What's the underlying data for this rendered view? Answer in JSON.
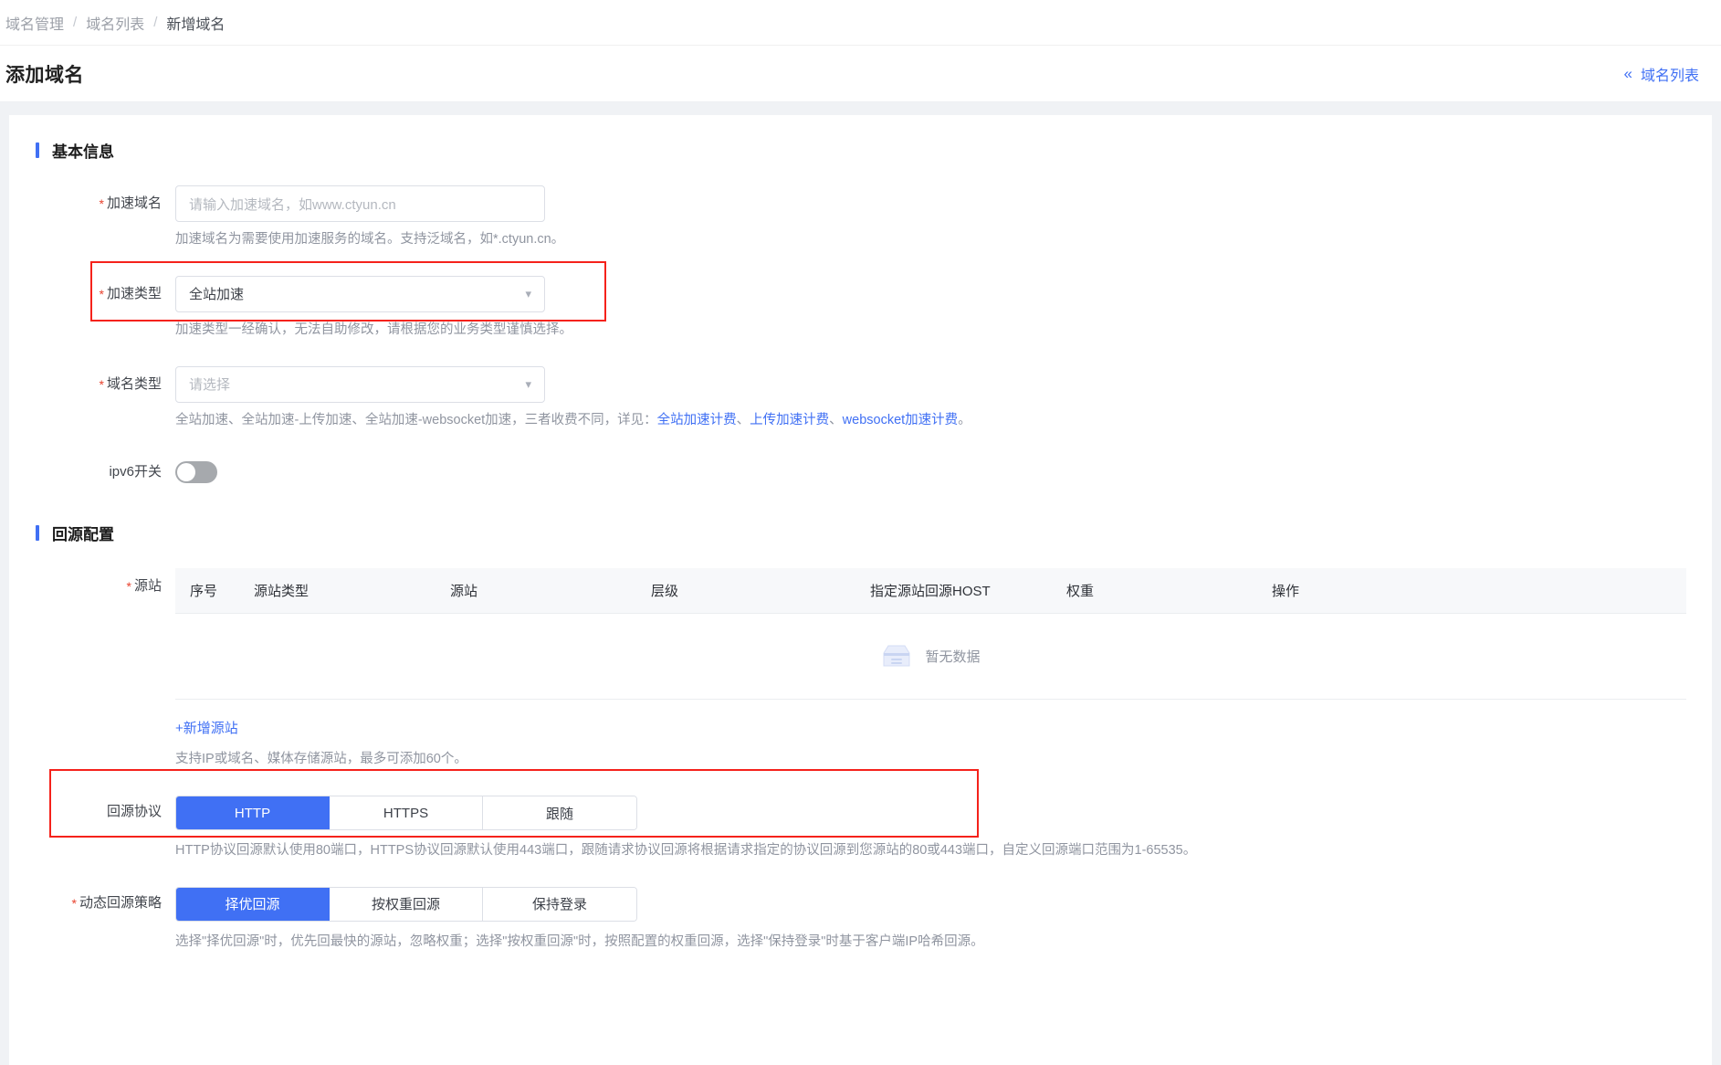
{
  "breadcrumb": {
    "items": [
      "域名管理",
      "域名列表",
      "新增域名"
    ],
    "separator": "/"
  },
  "header": {
    "title": "添加域名",
    "back_link_label": "域名列表",
    "back_link_icon": "double-chevron-left-icon"
  },
  "sections": {
    "basic_info": {
      "title": "基本信息",
      "domain": {
        "label": "加速域名",
        "required": true,
        "value": "",
        "placeholder": "请输入加速域名，如www.ctyun.cn",
        "hint": "加速域名为需要使用加速服务的域名。支持泛域名，如*.ctyun.cn。"
      },
      "accel_type": {
        "label": "加速类型",
        "required": true,
        "value": "全站加速",
        "hint": "加速类型一经确认，无法自助修改，请根据您的业务类型谨慎选择。",
        "highlighted": true
      },
      "domain_type": {
        "label": "域名类型",
        "required": true,
        "value": "请选择",
        "hint_prefix": "全站加速、全站加速-上传加速、全站加速-websocket加速，三者收费不同，详见：",
        "links": [
          "全站加速计费",
          "上传加速计费",
          "websocket加速计费"
        ],
        "link_sep": "、",
        "hint_suffix": "。"
      },
      "ipv6": {
        "label": "ipv6开关",
        "enabled": false
      }
    },
    "origin_config": {
      "title": "回源配置",
      "origin": {
        "label": "源站",
        "required": true,
        "columns": [
          "序号",
          "源站类型",
          "源站",
          "层级",
          "指定源站回源HOST",
          "权重",
          "操作"
        ],
        "rows": [],
        "empty_text": "暂无数据",
        "empty_icon": "empty-box-icon",
        "add_label": "+新增源站",
        "hint": "支持IP或域名、媒体存储源站，最多可添加60个。"
      },
      "origin_protocol": {
        "label": "回源协议",
        "options": [
          "HTTP",
          "HTTPS",
          "跟随"
        ],
        "selected": "HTTP",
        "hint": "HTTP协议回源默认使用80端口，HTTPS协议回源默认使用443端口，跟随请求协议回源将根据请求指定的协议回源到您源站的80或443端口，自定义回源端口范围为1-65535。"
      },
      "dynamic_policy": {
        "label": "动态回源策略",
        "required": true,
        "options": [
          "择优回源",
          "按权重回源",
          "保持登录"
        ],
        "selected": "择优回源",
        "hint": "选择\"择优回源\"时，优先回最快的源站，忽略权重；选择\"按权重回源\"时，按照配置的权重回源，选择\"保持登录\"时基于客户端IP哈希回源。",
        "highlighted": true
      }
    }
  },
  "colors": {
    "accent_blue": "#4070f4",
    "highlight_red": "#f5221b",
    "label_gray": "#42464d",
    "hint_gray": "#9095a0"
  }
}
